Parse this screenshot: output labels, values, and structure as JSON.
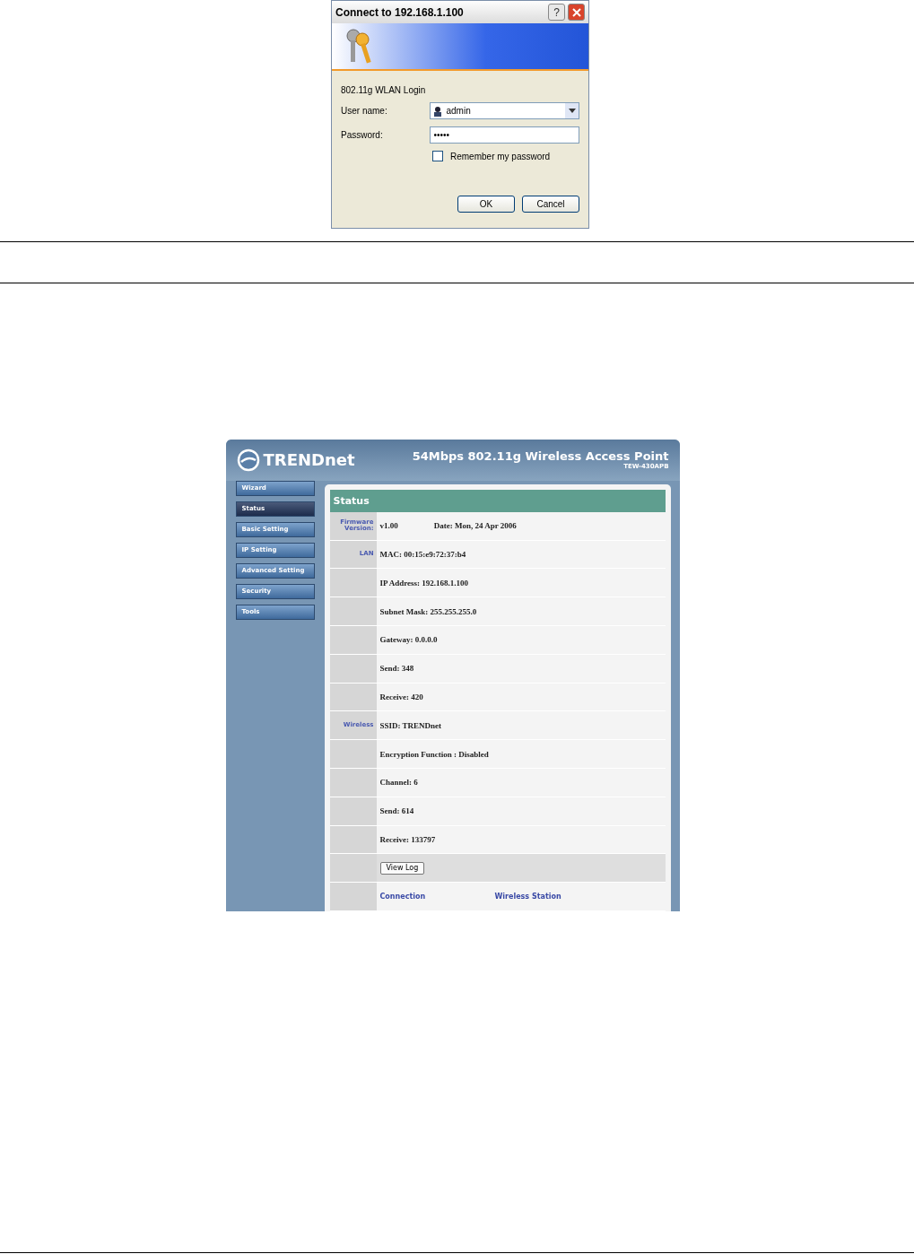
{
  "login_dialog": {
    "title": "Connect to 192.168.1.100",
    "help_button": "?",
    "message": "802.11g WLAN Login",
    "username_label": "User name:",
    "username": "admin",
    "password_label": "Password:",
    "password": "•••••",
    "remember": {
      "label": "Remember my password",
      "checked": false
    },
    "buttons": [
      "OK",
      "Cancel"
    ]
  },
  "router_page": {
    "brand": "TRENDnet",
    "title": "54Mbps 802.11g Wireless Access Point",
    "model": "TEW-430APB",
    "nav": [
      {
        "label": "Wizard",
        "selected": false
      },
      {
        "label": "Status",
        "selected": true
      },
      {
        "label": "Basic Setting",
        "selected": false
      },
      {
        "label": "IP Setting",
        "selected": false
      },
      {
        "label": "Advanced Setting",
        "selected": false
      },
      {
        "label": "Security",
        "selected": false
      },
      {
        "label": "Tools",
        "selected": false
      }
    ],
    "panel_title": "Status",
    "rows": [
      {
        "kind": "text",
        "label": "Firmware Version:",
        "value": "v1.00",
        "extra": "Date:  Mon, 24 Apr 2006"
      },
      {
        "kind": "text",
        "label": "LAN",
        "value": "MAC: 00:15:e9:72:37:b4"
      },
      {
        "kind": "text",
        "value": "IP Address: 192.168.1.100"
      },
      {
        "kind": "text",
        "value": "Subnet Mask: 255.255.255.0"
      },
      {
        "kind": "text",
        "value": "Gateway: 0.0.0.0"
      },
      {
        "kind": "text",
        "value": "Send: 348"
      },
      {
        "kind": "text",
        "value": "Receive: 420"
      },
      {
        "kind": "text",
        "label": "Wireless",
        "value": "SSID: TRENDnet"
      },
      {
        "kind": "text",
        "value": "Encryption Function : Disabled"
      },
      {
        "kind": "text",
        "value": "Channel: 6"
      },
      {
        "kind": "text",
        "value": "Send: 614"
      },
      {
        "kind": "text",
        "value": "Receive: 133797"
      },
      {
        "kind": "button",
        "value": "View Log"
      },
      {
        "kind": "heading",
        "value": "Connection",
        "extra": "Wireless Station"
      }
    ]
  }
}
